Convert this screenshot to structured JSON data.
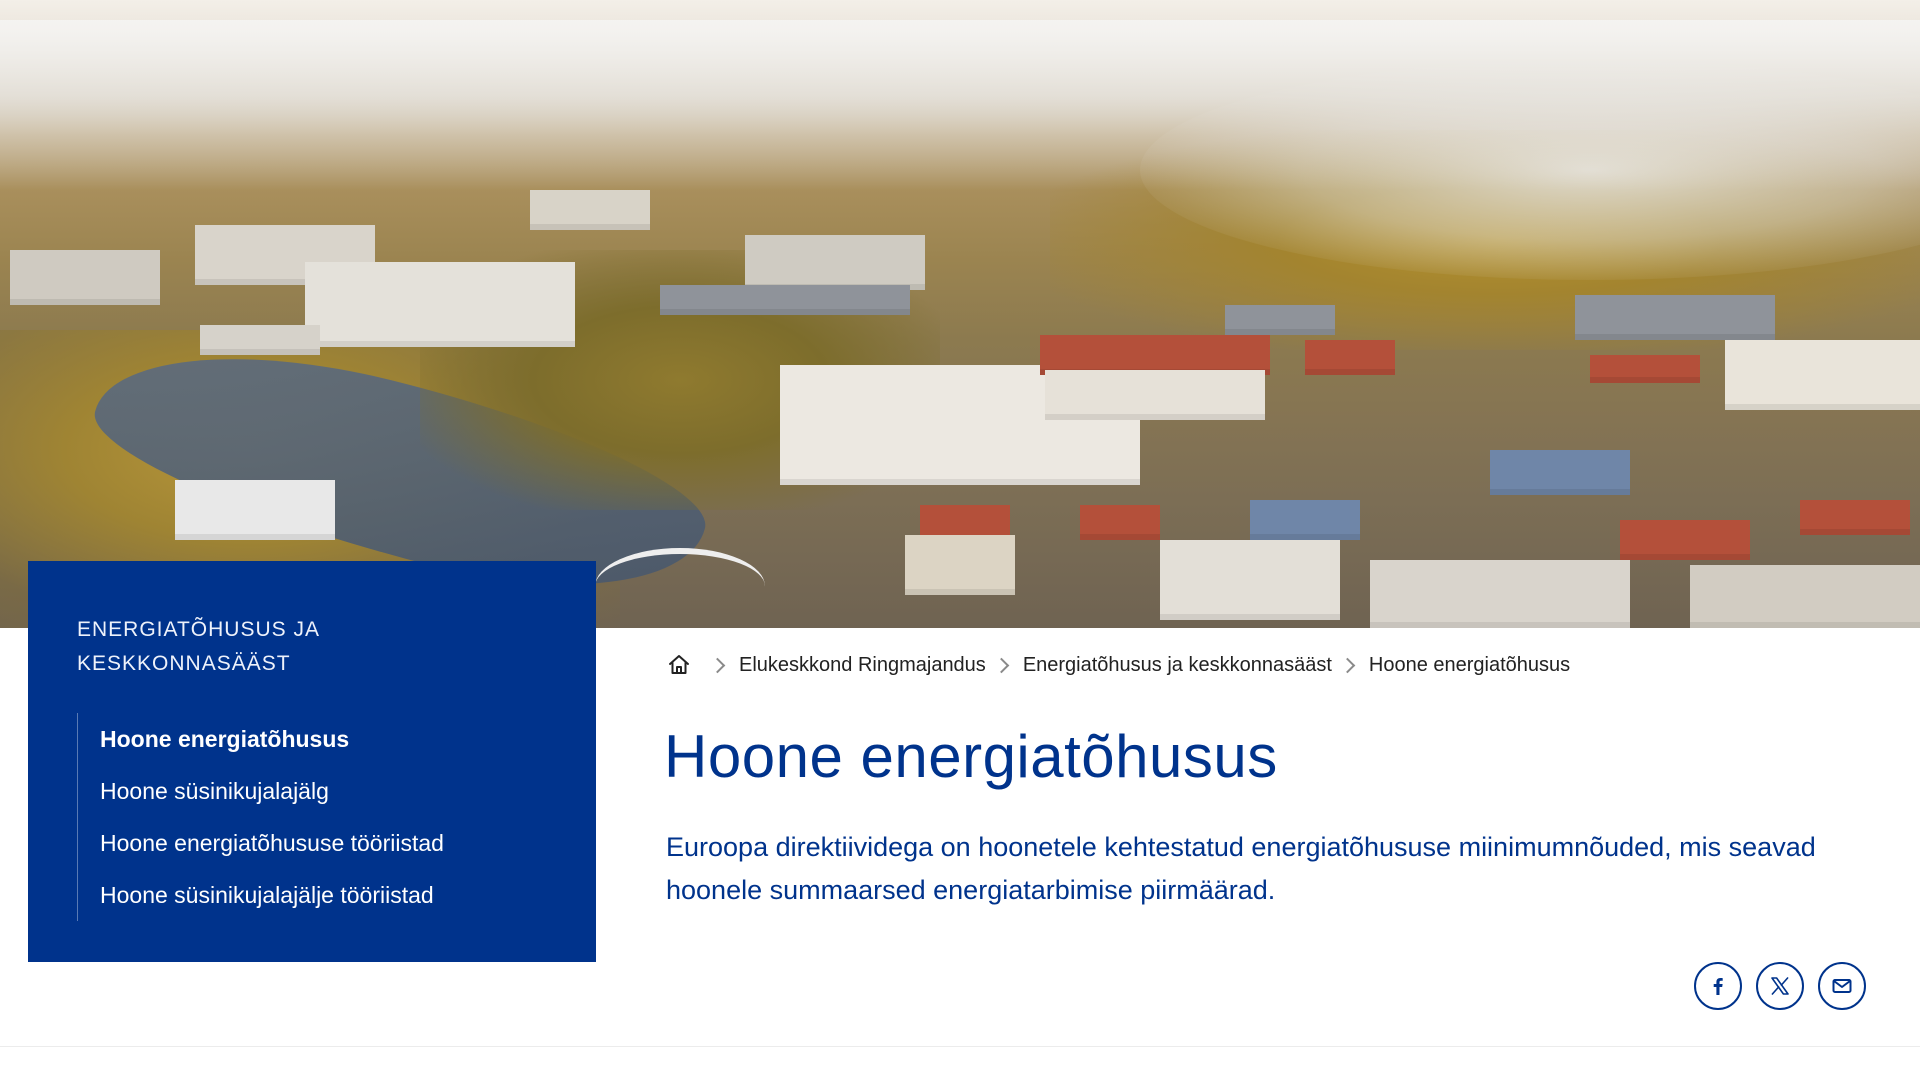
{
  "hero": {
    "image_subject": "aerial-city-view"
  },
  "sidebar": {
    "heading": "ENERGIATÕHUSUS JA KESKKONNASÄÄST",
    "items": [
      {
        "label": "Hoone energiatõhusus",
        "active": true
      },
      {
        "label": "Hoone süsinikujalajälg",
        "active": false
      },
      {
        "label": "Hoone energiatõhususe tööriistad",
        "active": false
      },
      {
        "label": "Hoone süsinikujalajälje tööriistad",
        "active": false
      }
    ]
  },
  "breadcrumb": {
    "home_icon": "home-icon",
    "items": [
      {
        "label": "Elukeskkond Ringmajandus"
      },
      {
        "label": "Energiatõhusus ja keskkonnasääst"
      },
      {
        "label": "Hoone energiatõhusus"
      }
    ]
  },
  "main": {
    "title": "Hoone energiatõhusus",
    "lead": "Euroopa direktiividega on hoonetele kehtestatud energiatõhususe miinimumnõuded, mis seavad hoonele summaarsed energiatarbimise piirmäärad."
  },
  "share": {
    "icons": [
      "facebook-icon",
      "x-icon",
      "email-icon"
    ]
  },
  "colors": {
    "brand_blue": "#00338c",
    "text_dark": "#222222"
  }
}
